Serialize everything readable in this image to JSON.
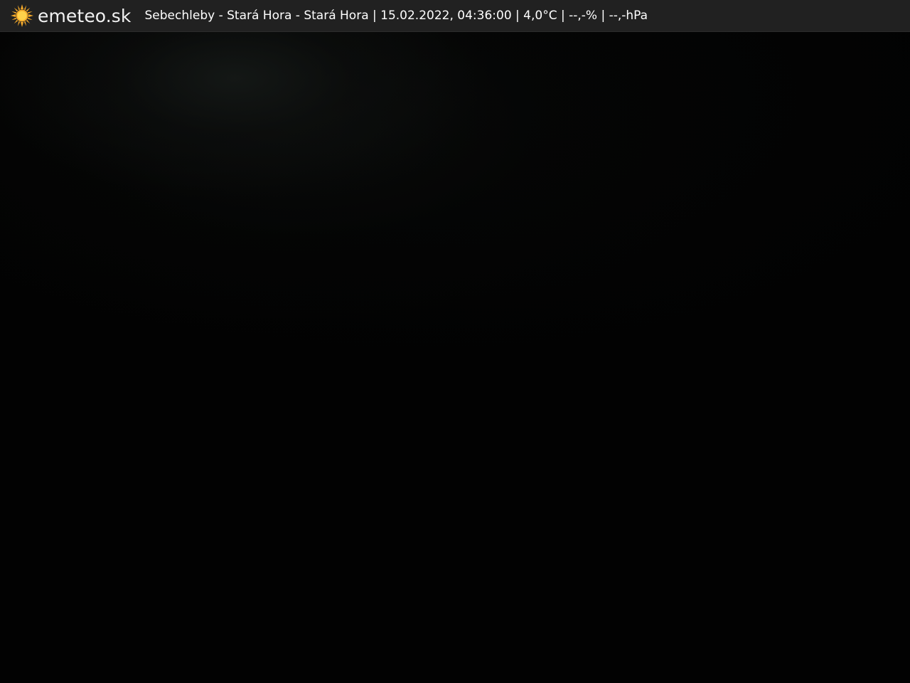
{
  "overlay": {
    "brand": "emeteo.sk",
    "caption": "Sebechleby - Stará Hora - Stará Hora | 15.02.2022, 04:36:00 | 4,0°C | --,-% | --,-hPa",
    "logo_icon": "sun-icon"
  },
  "colors": {
    "bar_background": "#212121",
    "sun_outer": "#f4a92a",
    "sun_inner": "#ffd24a",
    "text": "#ffffff"
  }
}
